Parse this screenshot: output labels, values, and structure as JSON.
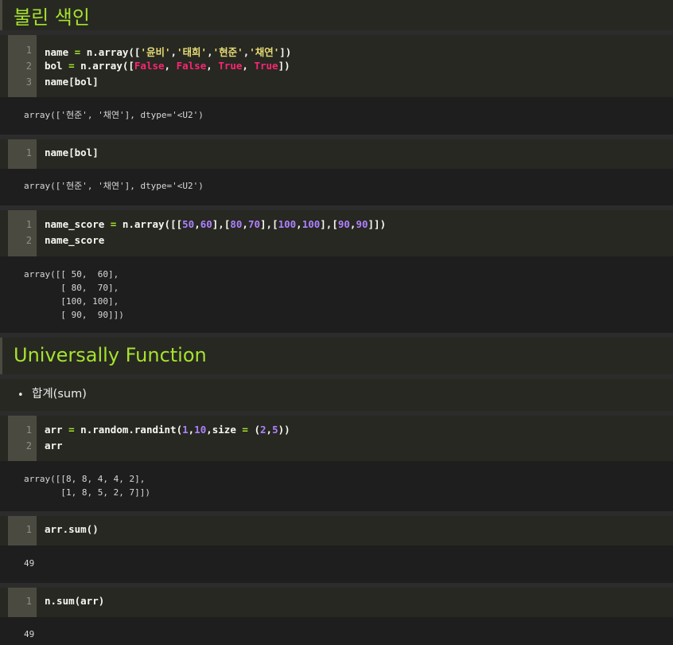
{
  "heading1": "불린 색인",
  "heading2": "Universally Function",
  "bullet": {
    "marker": "•",
    "text": "합계(sum)"
  },
  "cells": {
    "c1": {
      "lines": [
        "1",
        "2",
        "3"
      ],
      "out": "array(['현준', '채연'], dtype='<U2')"
    },
    "c2": {
      "lines": [
        "1"
      ],
      "code": "name[bol]",
      "out": "array(['현준', '채연'], dtype='<U2')"
    },
    "c3": {
      "lines": [
        "1",
        "2"
      ],
      "out": "array([[ 50,  60],\n       [ 80,  70],\n       [100, 100],\n       [ 90,  90]])"
    },
    "c4": {
      "lines": [
        "1",
        "2"
      ],
      "out": "array([[8, 8, 4, 4, 2],\n       [1, 8, 5, 2, 7]])"
    },
    "c5": {
      "lines": [
        "1"
      ],
      "code": "arr.sum()",
      "out": "49"
    },
    "c6": {
      "lines": [
        "1"
      ],
      "code": "n.sum(arr)",
      "out": "49"
    }
  },
  "tokens": {
    "name": "name",
    "eq": "=",
    "n_array_open": "n.array([",
    "s1": "'윤비'",
    "comma": ",",
    "s2": "'태희'",
    "s3": "'현준'",
    "s4": "'채연'",
    "close_bracket_paren": "])",
    "bol": "bol",
    "false": "False",
    "true": "True",
    "comma_sp": ", ",
    "name_bol": "name[bol]",
    "name_score": "name_score",
    "n_array_dbl": "n.array([[",
    "n50": "50",
    "n60": "60",
    "n80": "80",
    "n70": "70",
    "n100": "100",
    "n90": "90",
    "mid": "],[",
    "end_dbl": "]])",
    "arr": "arr",
    "randint": "n.random.randint(",
    "n1": "1",
    "n10": "10",
    "size": ",size",
    "paren_open": " (",
    "n2": "2",
    "n5": "5",
    "paren_close": "))"
  },
  "colors": {
    "heading": "#a6e22e",
    "keyword": "#f92672",
    "string": "#e6db74",
    "number": "#ae81ff",
    "operator": "#a6e22e",
    "code_bg": "#272822",
    "gutter_bg": "#4a4a40"
  }
}
